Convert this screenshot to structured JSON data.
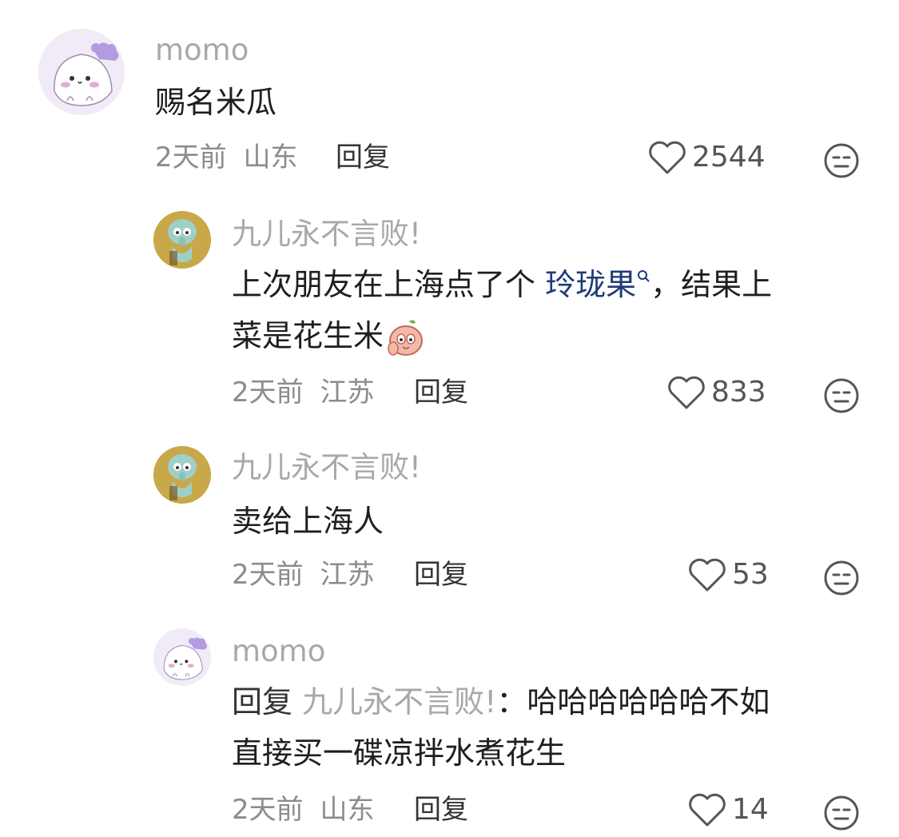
{
  "comments": [
    {
      "user": "momo",
      "text": "赐名米瓜",
      "time": "2天前",
      "location": "山东",
      "reply_label": "回复",
      "likes": "2544"
    },
    {
      "user": "九儿永不言败!",
      "text_a": "上次朋友在上海点了个 ",
      "link": "玲珑果",
      "text_b": "，结果上",
      "text_c": "菜是花生米",
      "time": "2天前",
      "location": "江苏",
      "reply_label": "回复",
      "likes": "833"
    },
    {
      "user": "九儿永不言败!",
      "text": "卖给上海人",
      "time": "2天前",
      "location": "江苏",
      "reply_label": "回复",
      "likes": "53"
    },
    {
      "user": "momo",
      "reply_prefix": "回复 ",
      "reply_target": "九儿永不言败!",
      "text_a": "：哈哈哈哈哈哈不如",
      "text_b": "直接买一碟凉拌水煮花生",
      "time": "2天前",
      "location": "山东",
      "reply_label": "回复",
      "likes": "14"
    }
  ],
  "colors": {
    "username": "#a8a8a8",
    "link": "#1f3a78",
    "meta": "#8c8c8c"
  }
}
